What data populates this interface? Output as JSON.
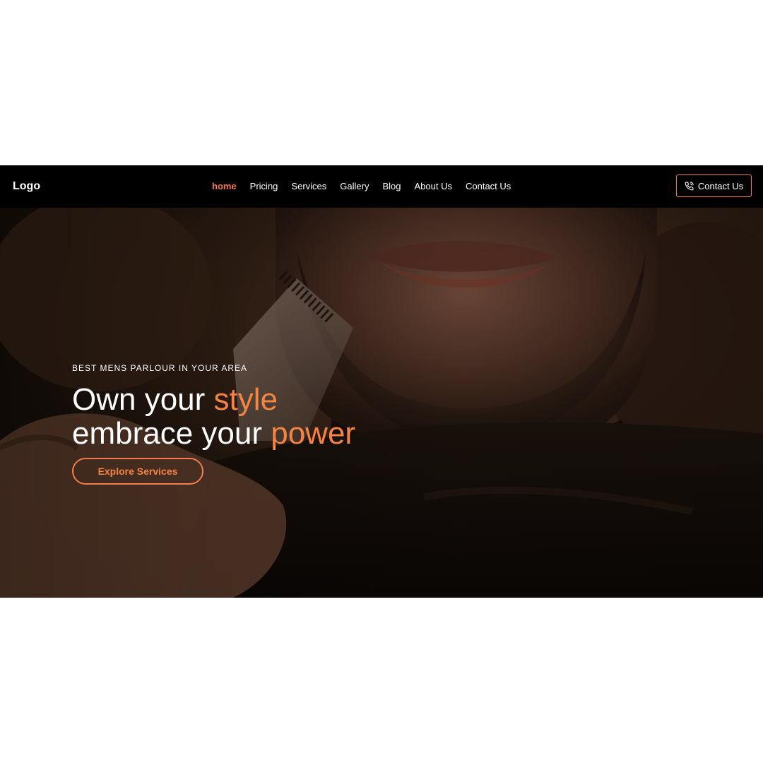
{
  "nav": {
    "logo": "Logo",
    "links": [
      {
        "label": "home",
        "active": true
      },
      {
        "label": "Pricing",
        "active": false
      },
      {
        "label": "Services",
        "active": false
      },
      {
        "label": "Gallery",
        "active": false
      },
      {
        "label": "Blog",
        "active": false
      },
      {
        "label": "About Us",
        "active": false
      },
      {
        "label": "Contact Us",
        "active": false
      }
    ],
    "cta_label": "Contact Us",
    "cta_icon": "phone-icon"
  },
  "hero": {
    "tagline": "BEST MENS PARLOUR IN YOUR AREA",
    "headline_line1_plain": "Own your ",
    "headline_line1_accent": "style",
    "headline_line2_plain": "embrace your ",
    "headline_line2_accent": "power",
    "button_label": "Explore Services",
    "image": "man-beard-trimming-photo"
  },
  "colors": {
    "accent": "#f37b4c",
    "navbar_bg": "#000000",
    "text": "#ffffff"
  }
}
